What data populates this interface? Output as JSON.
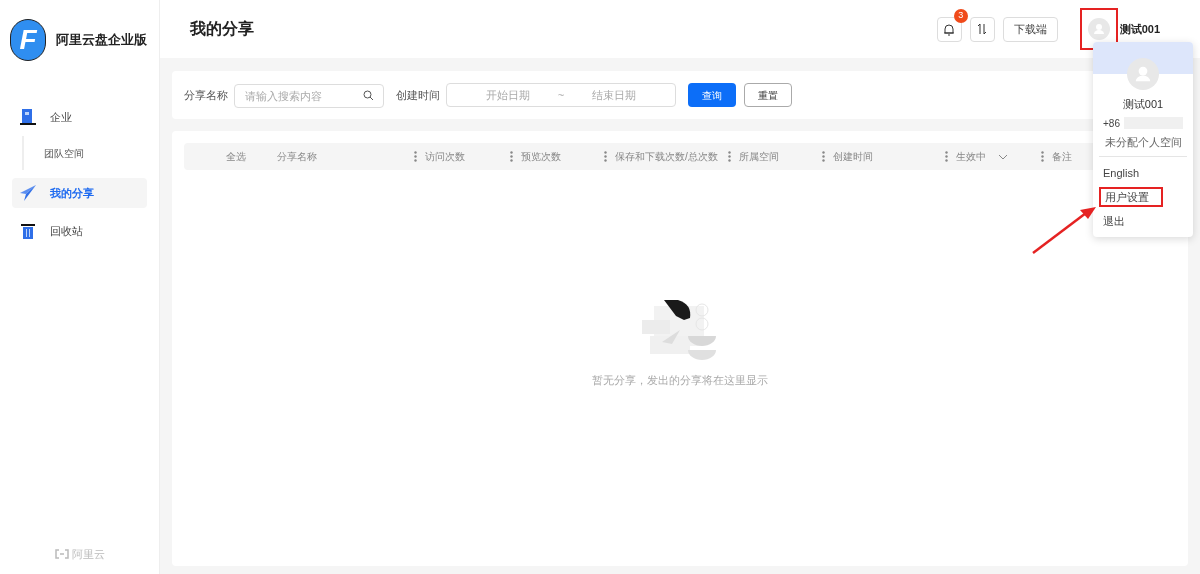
{
  "app": {
    "name": "阿里云盘企业版",
    "logo_letter": "F"
  },
  "page_title": "我的分享",
  "sidebar": {
    "items": [
      {
        "label": "企业",
        "selected": false,
        "children": [
          {
            "label": "团队空间",
            "selected": false
          }
        ]
      },
      {
        "label": "我的分享",
        "selected": true
      },
      {
        "label": "回收站",
        "selected": false
      }
    ],
    "footer": "阿里云"
  },
  "header": {
    "notification_count": "3",
    "download_button": "下载端",
    "user_name": "测试001",
    "avatar_annotated": true
  },
  "filter": {
    "name_label": "分享名称",
    "name_placeholder": "请输入搜索内容",
    "time_label": "创建时间",
    "start_placeholder": "开始日期",
    "range_sep": "~",
    "end_placeholder": "结束日期",
    "query_button": "查询",
    "reset_button": "重置"
  },
  "table": {
    "columns": [
      {
        "label": "全选",
        "kind": "plain"
      },
      {
        "label": "分享名称",
        "kind": "plain"
      },
      {
        "label": "访问次数",
        "kind": "resizable"
      },
      {
        "label": "预览次数",
        "kind": "resizable"
      },
      {
        "label": "保存和下载次数/总次数",
        "kind": "resizable"
      },
      {
        "label": "所属空间",
        "kind": "resizable"
      },
      {
        "label": "创建时间",
        "kind": "resizable"
      },
      {
        "label": "生效中",
        "kind": "dropdown"
      },
      {
        "label": "备注",
        "kind": "resizable"
      }
    ],
    "empty_text": "暂无分享，发出的分享将在这里显示"
  },
  "user_menu": {
    "name": "测试001",
    "phone_prefix": "+86",
    "space": "未分配个人空间",
    "items": [
      {
        "label": "English",
        "annotated": false
      },
      {
        "label": "用户设置",
        "annotated": true
      },
      {
        "label": "退出",
        "annotated": false
      }
    ]
  }
}
